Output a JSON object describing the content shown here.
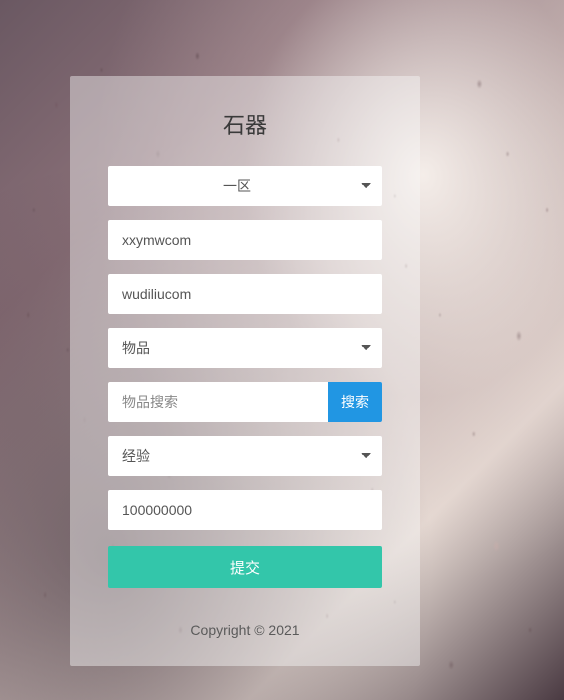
{
  "title": "石器",
  "region_select": {
    "value": "一区"
  },
  "account_input": {
    "value": "xxymwcom"
  },
  "char_input": {
    "value": "wudiliucom"
  },
  "item_type_select": {
    "value": "物品"
  },
  "search": {
    "placeholder": "物品搜索",
    "button": "搜索"
  },
  "reward_type_select": {
    "value": "经验"
  },
  "amount_input": {
    "value": "100000000"
  },
  "submit_button": "提交",
  "copyright": "Copyright © 2021"
}
